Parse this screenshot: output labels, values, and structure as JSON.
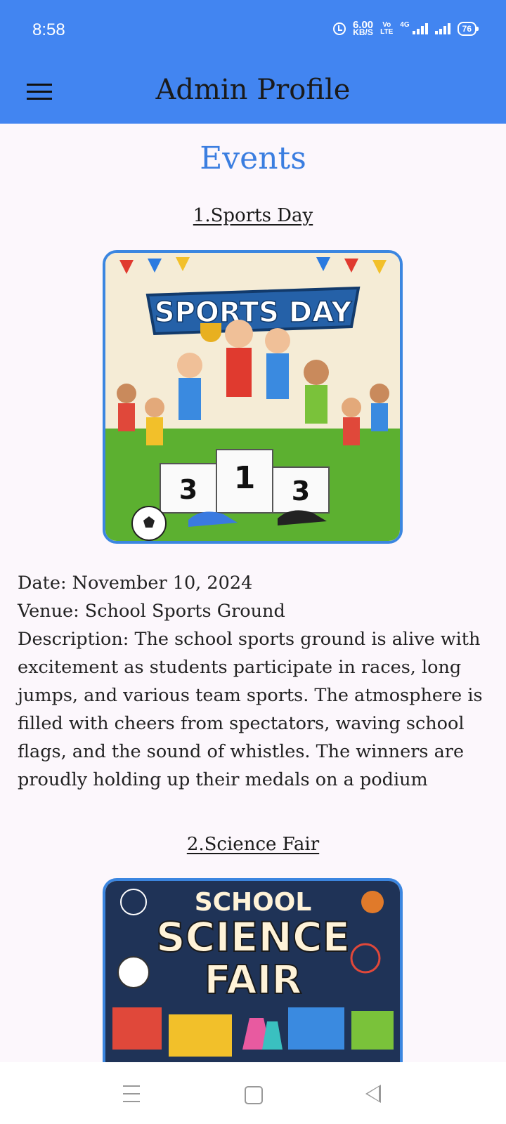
{
  "status_bar": {
    "time": "8:58",
    "speed_value": "6.00",
    "speed_unit": "KB/S",
    "volte_top": "Vo",
    "volte_bottom": "LTE",
    "network": "4G",
    "battery": "76",
    "icons": [
      "alarm-icon",
      "signal-icon",
      "signal-icon",
      "battery-icon"
    ]
  },
  "app_bar": {
    "title": "Admin Profile",
    "menu_icon": "hamburger-menu-icon"
  },
  "page": {
    "title": "Events"
  },
  "events": [
    {
      "title": "1.Sports Day",
      "date": "Date: November 10, 2024",
      "venue": "Venue: School Sports Ground",
      "description": "Description: The school sports ground is alive with excitement as students participate in races, long jumps, and various team sports. The atmosphere is filled with cheers from spectators, waving school flags, and the sound of whistles. The winners are proudly holding up their medals on a podium",
      "banner_text": "SPORTS DAY",
      "podium": [
        "3",
        "1",
        "3"
      ]
    },
    {
      "title": "2.Science Fair",
      "banner_line1": "SCHOOL",
      "banner_line2": "SCIENCE",
      "banner_line3": "FAIR"
    }
  ],
  "nav_bar": {
    "icons": [
      "recents-icon",
      "home-icon",
      "back-icon"
    ]
  },
  "colors": {
    "primary": "#4285f1",
    "heading": "#3b7ee0",
    "background": "#fcf7fc"
  }
}
